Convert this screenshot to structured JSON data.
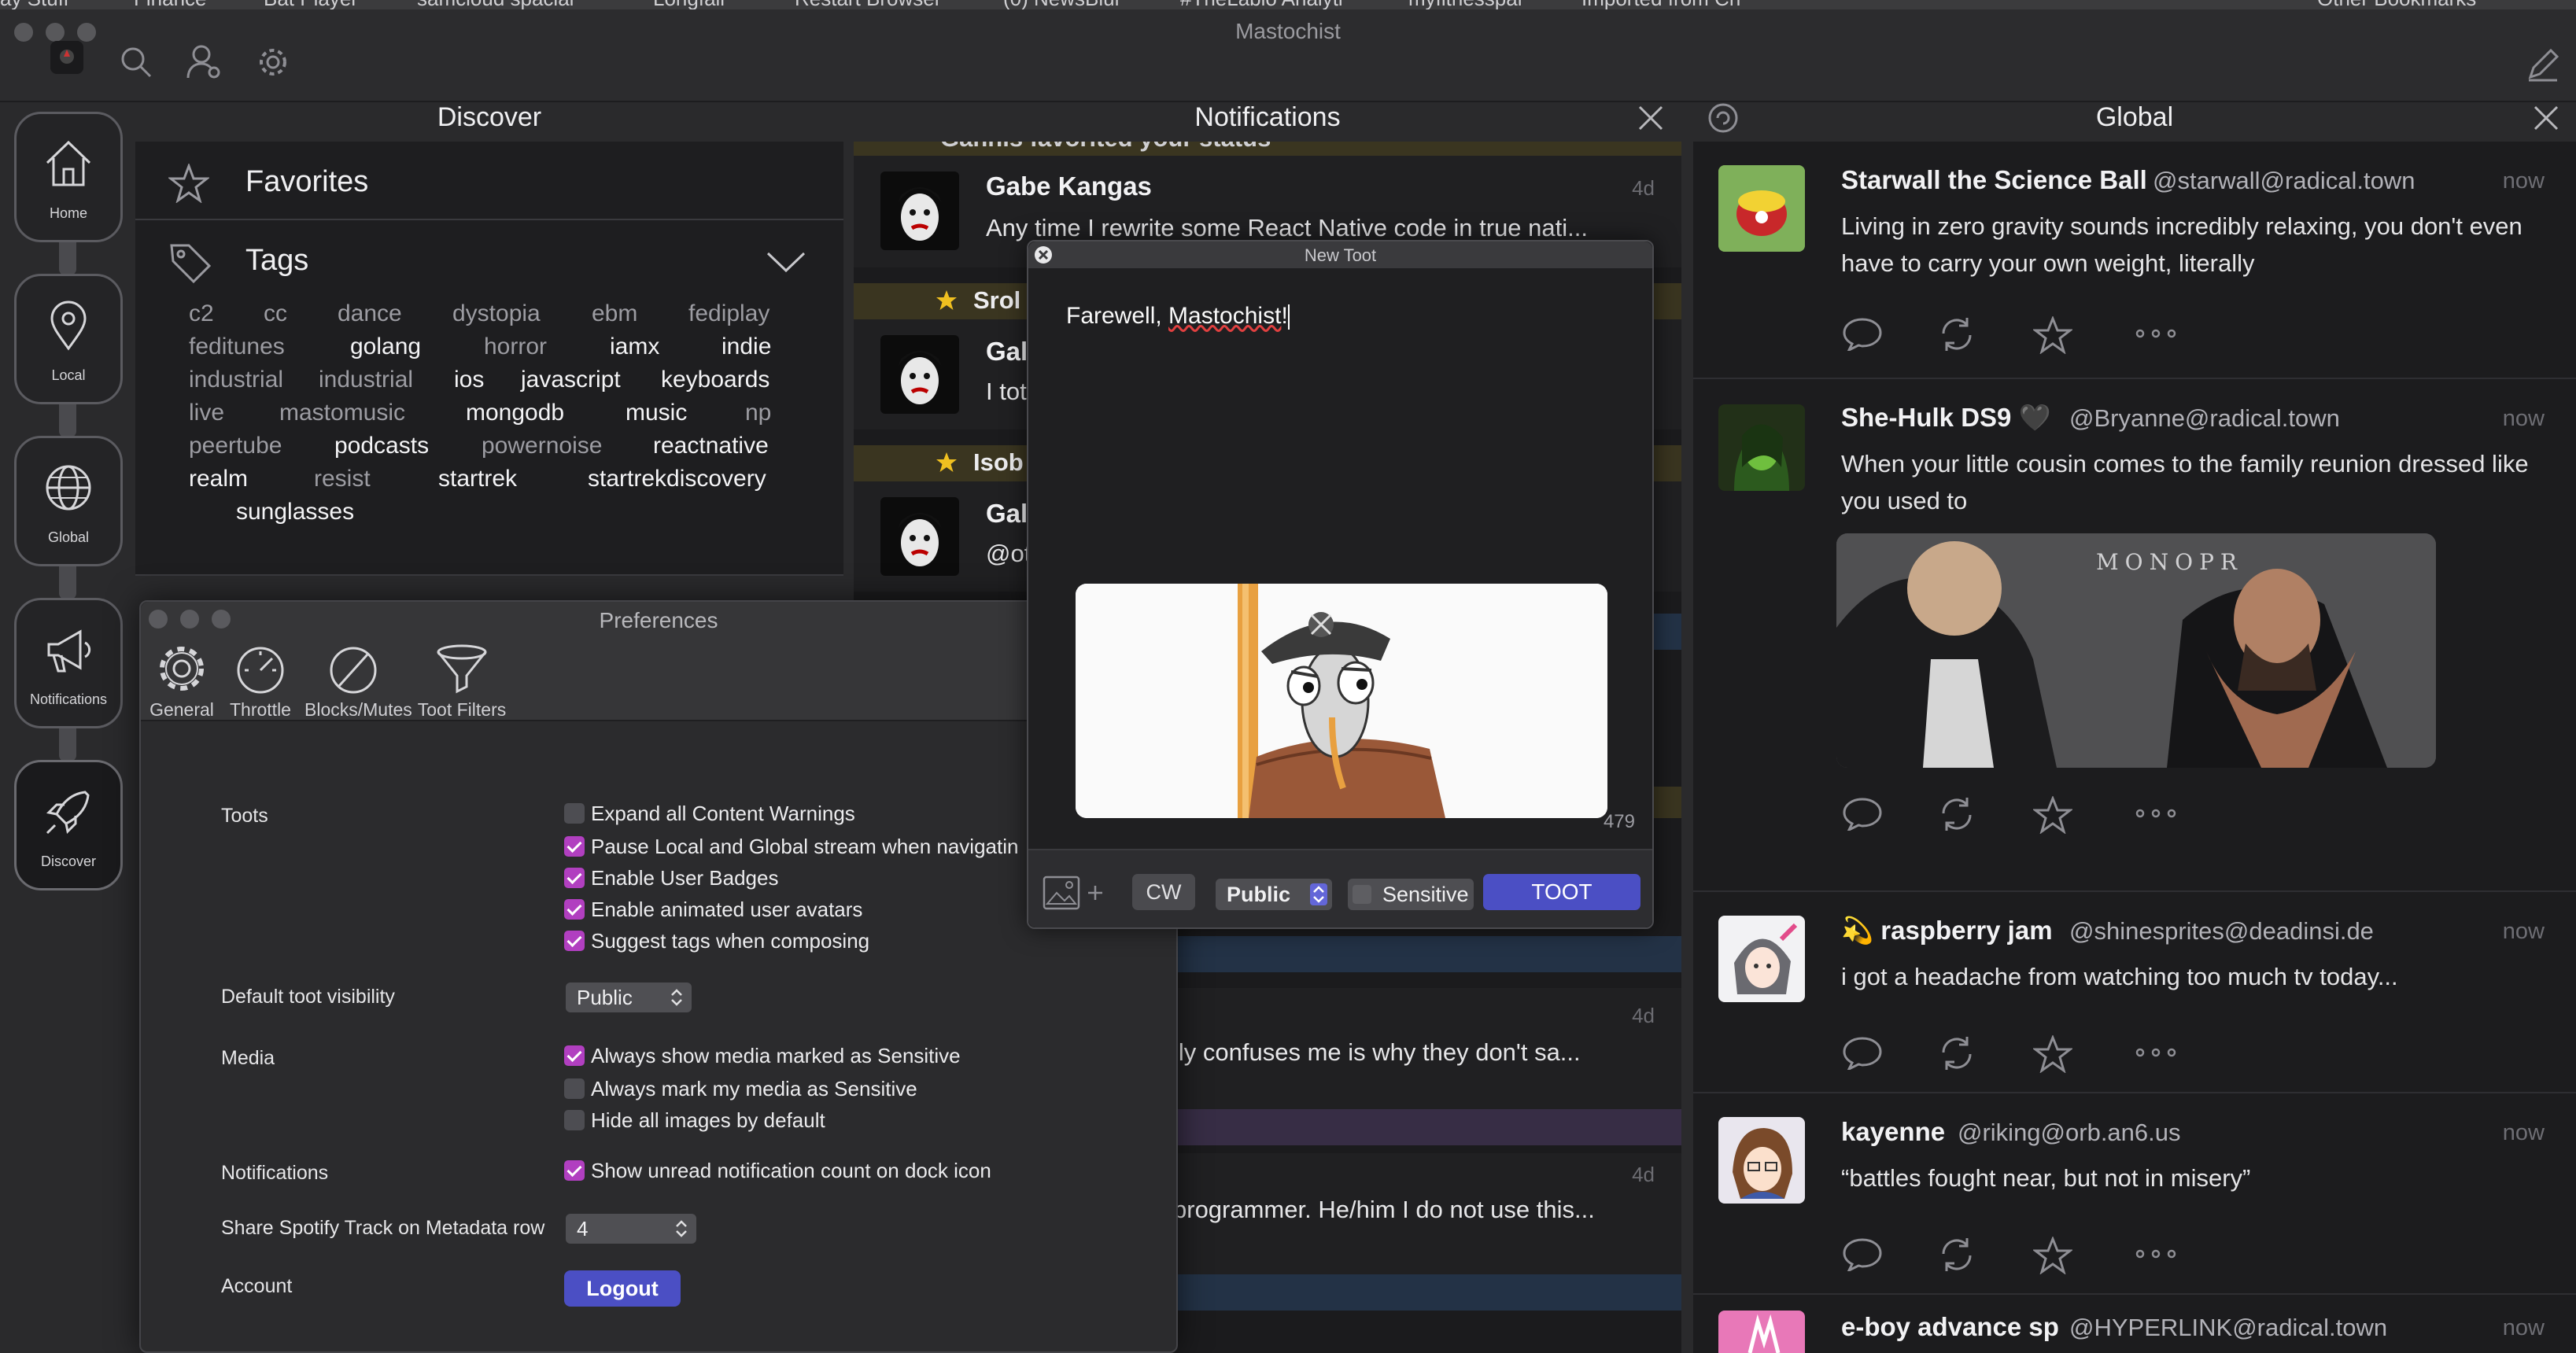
{
  "bookmarks": [
    "ay Stuff",
    "Finance",
    "Bat Player",
    "samcloud spacial",
    "Longfall",
    "Restart Browser",
    "(0) NewsBlur",
    "#TheLabio Analyti",
    "myfitnesspal",
    "Imported from Ch",
    "Other Bookmarks"
  ],
  "window": {
    "title": "Mastochist"
  },
  "sidebar": {
    "items": [
      {
        "label": "Home",
        "icon": "home-icon"
      },
      {
        "label": "Local",
        "icon": "map-pin-icon"
      },
      {
        "label": "Global",
        "icon": "globe-icon"
      },
      {
        "label": "Notifications",
        "icon": "megaphone-icon"
      },
      {
        "label": "Discover",
        "icon": "rocket-icon"
      }
    ]
  },
  "discover": {
    "title": "Discover",
    "favorites_label": "Favorites",
    "tags_label": "Tags",
    "tags": [
      "c2",
      "cc",
      "dance",
      "dystopia",
      "ebm",
      "fediplay",
      "feditunes",
      "golang",
      "horror",
      "iamx",
      "indie",
      "industrial",
      "industrial",
      "ios",
      "javascript",
      "keyboards",
      "live",
      "mastomusic",
      "mongodb",
      "music",
      "np",
      "peertube",
      "podcasts",
      "powernoise",
      "reactnative",
      "realm",
      "resist",
      "startrek",
      "startrekdiscovery",
      "sunglasses"
    ]
  },
  "notifications": {
    "title": "Notifications",
    "partial_header": "Gannis favorited your status",
    "items": [
      {
        "name": "Gabe Kangas",
        "text": "Any time I rewrite some React Native code in true nati...",
        "time": "4d"
      },
      {
        "header": "Srol",
        "name": "Gal",
        "text": "I tot"
      },
      {
        "header": "Isob",
        "name": "Gal",
        "text": "@ot"
      },
      {
        "text": "lly confuses me is why they don't sa...",
        "time": "4d"
      },
      {
        "text": "programmer. He/him I do not use this...",
        "time": "4d"
      }
    ]
  },
  "global": {
    "title": "Global",
    "posts": [
      {
        "name": "Starwall the Science Ball",
        "handle": "@starwall@radical.town",
        "time": "now",
        "text": "Living in zero gravity sounds incredibly relaxing, you don't even have to carry your own weight, literally"
      },
      {
        "name": "She-Hulk DS9 🖤",
        "handle": "@Bryanne@radical.town",
        "time": "now",
        "text": "When your little cousin comes to the family reunion dressed like you used to",
        "media_text": "MONOPR"
      },
      {
        "name": "💫 raspberry jam",
        "handle": "@shinesprites@deadinsi.de",
        "time": "now",
        "text": "i got a headache from watching too much tv today..."
      },
      {
        "name": "kayenne",
        "handle": "@riking@orb.an6.us",
        "time": "now",
        "text": "“battles fought near, but not in misery”"
      },
      {
        "name": "e-boy advance sp",
        "handle": "@HYPERLINK@radical.town",
        "time": "now",
        "text": ""
      }
    ]
  },
  "preferences": {
    "title": "Preferences",
    "tabs": [
      "General",
      "Throttle",
      "Blocks/Mutes",
      "Toot Filters"
    ],
    "toots_label": "Toots",
    "toots_options": [
      {
        "label": "Expand all Content Warnings",
        "checked": false
      },
      {
        "label": "Pause Local and Global stream when navigatin",
        "checked": true
      },
      {
        "label": "Enable User Badges",
        "checked": true
      },
      {
        "label": "Enable animated user avatars",
        "checked": true
      },
      {
        "label": "Suggest tags when composing",
        "checked": true
      }
    ],
    "visibility_label": "Default toot visibility",
    "visibility_value": "Public",
    "media_label": "Media",
    "media_options": [
      {
        "label": "Always show media marked as Sensitive",
        "checked": true
      },
      {
        "label": "Always mark my media as Sensitive",
        "checked": false
      },
      {
        "label": "Hide all images by default",
        "checked": false
      }
    ],
    "notifications_label": "Notifications",
    "notifications_option": {
      "label": "Show unread notification count on dock icon",
      "checked": true
    },
    "spotify_label": "Share Spotify Track on Metadata row",
    "spotify_value": "4",
    "account_label": "Account",
    "logout_label": "Logout"
  },
  "new_toot": {
    "title": "New Toot",
    "text_prefix": "Farewell, ",
    "text_misspelled": "Mastochist",
    "text_suffix": "!",
    "char_count": "479",
    "cw_label": "CW",
    "visibility_value": "Public",
    "sensitive_label": "Sensitive",
    "sensitive_checked": false,
    "submit_label": "TOOT"
  },
  "colors": {
    "accent": "#4b4fc4",
    "checkbox": "#b13fc0",
    "star": "#f0c020"
  }
}
